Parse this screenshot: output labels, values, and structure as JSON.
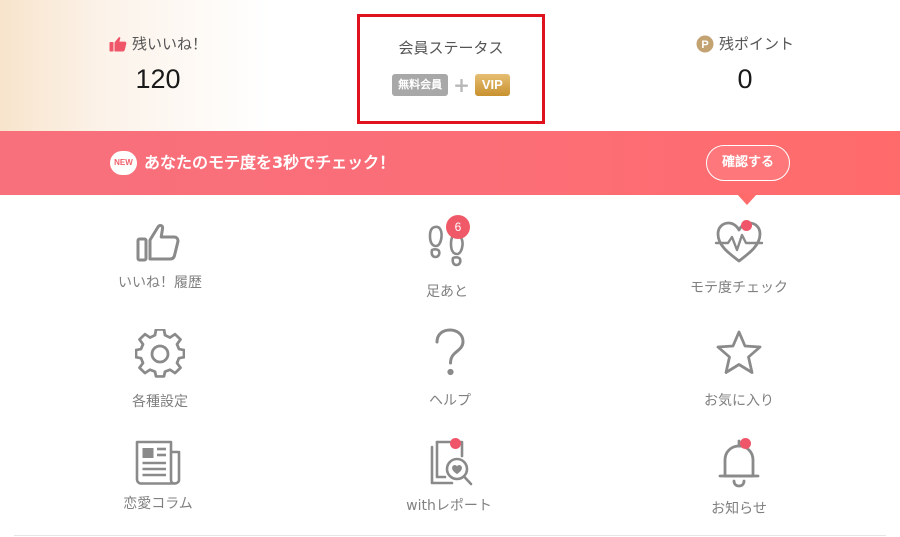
{
  "stats": {
    "likes_label": "残いいね！",
    "likes_value": "120",
    "status_label": "会員ステータス",
    "status_free_badge": "無料会員",
    "status_plus": "+",
    "status_vip_badge": "VIP",
    "points_label": "残ポイント",
    "points_value": "0",
    "points_icon_letter": "P"
  },
  "banner": {
    "new_badge": "NEW",
    "text": "あなたのモテ度を3秒でチェック！",
    "button_label": "確認する"
  },
  "menu": {
    "items": [
      {
        "label": "いいね！履歴",
        "icon": "thumbs-up-icon"
      },
      {
        "label": "足あと",
        "icon": "footprints-icon",
        "badge": "6"
      },
      {
        "label": "モテ度チェック",
        "icon": "heart-pulse-icon",
        "dot": true
      },
      {
        "label": "各種設定",
        "icon": "gear-icon"
      },
      {
        "label": "ヘルプ",
        "icon": "question-icon"
      },
      {
        "label": "お気に入り",
        "icon": "star-icon"
      },
      {
        "label": "恋愛コラム",
        "icon": "newspaper-icon"
      },
      {
        "label": "withレポート",
        "icon": "report-search-icon",
        "dot": true
      },
      {
        "label": "お知らせ",
        "icon": "bell-icon",
        "dot": true
      }
    ]
  },
  "colors": {
    "accent_red": "#e0121d",
    "banner_pink": "#f96e7a",
    "icon_gray": "#8a8a8a",
    "notification_dot": "#f0566a",
    "vip_gold": "#d4a04a"
  }
}
